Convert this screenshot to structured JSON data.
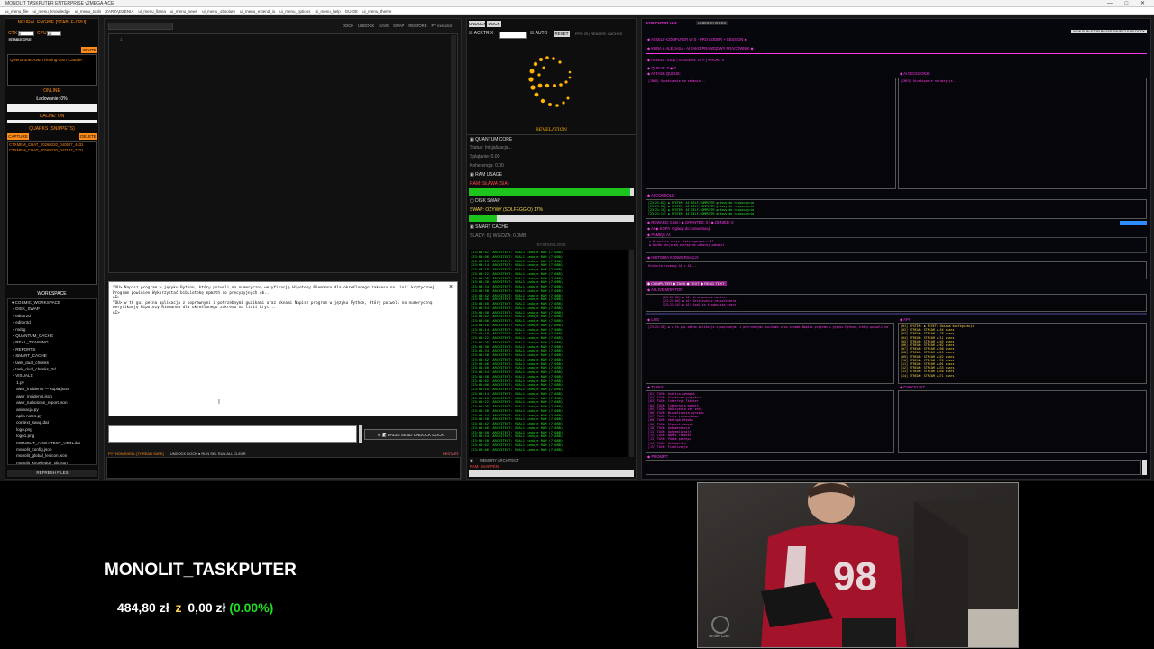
{
  "window": {
    "title": "MONOLIT TASKPUTER ENTERPRISE v2MEGA-ACE",
    "controls": [
      "—",
      "□",
      "✕"
    ]
  },
  "menubar": [
    "ui_menu_file",
    "ui_menu_knowledge",
    "ui_menu_tools",
    "ZARZĄDZENIA",
    "ui_menu_llama",
    "ui_menu_news",
    "ui_menu_obsolute",
    "ui_menu_extend_io",
    "ui_menu_options",
    "ui_menu_help",
    "GUIDE",
    "ui_menu_theme"
  ],
  "left": {
    "engine_title": "NEURAL ENGINE [STABLE-CPU]",
    "ctx_label": "CTX",
    "ctx_value": "0",
    "cpu_label": "CPU",
    "cpu_value": "16",
    "stable_tag": "[STABLE CPU]",
    "ignite": "IGNITE",
    "model": "Qwen3-30B-A3B-Thinking-2507-Claude-",
    "online": "ONLINE",
    "loading": "Ładowanie: 0%",
    "cache": "CACHE: ON",
    "quarks": "QUARKS (SNIPPETS)",
    "capture": "CAPTURE",
    "delete": "DELETE",
    "snippets": [
      "CTXMEM_CHAT_20260220_040527_4431",
      "CTXMEM_CHAT_20260220_043137_2221"
    ],
    "workspace": "WORKSPACE",
    "tree": [
      "COSMIC_WORKSPACE",
      "DISK_SWAP",
      "editor2d",
      "editor3d",
      "mdzg",
      "QUANTUM_CACHE",
      "REAL_TRAINING",
      "REPORTS",
      "SMART_CACHE",
      "task_dual_chunks",
      "task_dual_chunks_3d",
      "VISUALS",
      "1.py",
      "aiwir_incidents — kopia.json",
      "aiwir_incidents.json",
      "aiwir_turboscan_report.json",
      "animacja.py",
      "aplia notes.py",
      "context_swap.dat",
      "logo.png",
      "logo1.png",
      "MONOLIT_ARCHITECT_VEIN.dat",
      "monolit_config.json",
      "monolit_global_lexicon.json",
      "monolit_knowledge_db.json"
    ],
    "refresh": "REFRESH FILES"
  },
  "editor": {
    "tab": "",
    "toolbar": [
      "DOCK",
      "UNDOCK",
      "SAVE",
      "SWAP",
      "RESTORE",
      "PY executor"
    ],
    "line_no": "1",
    "chat": "YOU> Napisz program w języku Python, który pozwoli na numeryczną weryfikację Hipotezy Riemanna dla określonego zakresu na linii krytycznej. Program powinien:Wykorzystać bibliotekę mpmath do precyzyjnych ob...\nAI>\nYOU> w tk gui pełna aplikacja z poprawnymi i potrzebnymi guzikami oraz oknami Napisz program w języku Python, który pozwoli na numeryczną weryfikację Hipotezy Riemanna dla określonego zakresu na linii kryt...\nAI>",
    "send_buttons": "⚙ 🗐 DALEJ SEND UNDOCK DOCK",
    "shell_label": "PYTHON SHELL [THREAD SAFE]",
    "shell_buttons": "UNDOCK DOCK ● RUN SEL RUN ALL CLEAR",
    "shell_right": "RESTART"
  },
  "middle": {
    "undock": "UNDOCK",
    "dock": "DOCK",
    "acktrix": "ACKTRIX",
    "auto": "AUTO",
    "reset": "RESET",
    "stats": "FPS: 25 | RENDER: CACHED",
    "revelation": "REVELATION",
    "quantum_core": "QUANTUM CORE",
    "status": "Status: Inicjalizacja...",
    "splatanie": "Splątanie: 0.00",
    "koherencja": "Koherencja: 0.00",
    "ram_usage": "RAM USAGE",
    "ram_line": "RAM: SŁAWA (SIA)",
    "ram_fill": 0.98,
    "disk_swap": "DISK SWAP",
    "swap_line": "SWAP: OŻYWY (SOLFEGGIO) 17%",
    "swap_fill": 0.17,
    "smart_cache": "SMART CACHE",
    "slady": "ŚLADY: 6 | WIEDZA: 0.0MB",
    "system_logs": "SYSTEM LOGS",
    "log_lines": [
      "[23:03:02] ARCHITECT: VIAL1 Ładuje RAM (7.08B)",
      "[23:03:06] ARCHITECT: VIAL1 Ładuje RAM (7.08B)",
      "[23:03:10] ARCHITECT: VIAL1 Ładuje RAM (7.08B)",
      "[23:03:14] ARCHITECT: VIAL1 Ładuje RAM (7.08B)",
      "[23:03:18] ARCHITECT: VIAL1 Ładuje RAM (7.08B)",
      "[23:03:22] ARCHITECT: VIAL1 Ładuje RAM (7.08B)",
      "[23:03:26] ARCHITECT: VIAL1 Ładuje RAM (7.08B)",
      "[23:03:30] ARCHITECT: VIAL1 Ładuje RAM (7.08B)",
      "[23:03:34] ARCHITECT: VIAL1 Ładuje RAM (7.08B)",
      "[23:03:38] ARCHITECT: VIAL1 Ładuje RAM (7.08B)",
      "[23:03:42] ARCHITECT: VIAL1 Ładuje RAM (7.08B)",
      "[23:03:46] ARCHITECT: VIAL1 Ładuje RAM (7.08B)",
      "[23:03:50] ARCHITECT: VIAL1 Ładuje RAM (7.08B)",
      "[23:03:54] ARCHITECT: VIAL1 Ładuje RAM (7.08B)",
      "[23:03:58] ARCHITECT: VIAL1 Ładuje RAM (7.08B)",
      "[23:04:02] ARCHITECT: VIAL1 Ładuje RAM (7.08B)",
      "[23:04:06] ARCHITECT: VIAL1 Ładuje RAM (7.08B)",
      "[23:04:10] ARCHITECT: VIAL1 Ładuje RAM (7.08B)",
      "[23:04:14] ARCHITECT: VIAL1 Ładuje RAM (7.08B)",
      "[23:04:18] ARCHITECT: VIAL1 Ładuje RAM (7.08B)",
      "[23:04:22] ARCHITECT: VIAL1 Ładuje RAM (7.08B)",
      "[23:04:26] ARCHITECT: VIAL1 Ładuje RAM (7.08B)",
      "[23:04:30] ARCHITECT: VIAL1 Ładuje RAM (7.08B)",
      "[23:04:34] ARCHITECT: VIAL1 Ładuje RAM (7.08B)",
      "[23:04:38] ARCHITECT: VIAL1 Ładuje RAM (7.08B)",
      "[23:04:42] ARCHITECT: VIAL1 Ładuje RAM (7.08B)",
      "[23:04:46] ARCHITECT: VIAL1 Ładuje RAM (7.08B)",
      "[23:04:50] ARCHITECT: VIAL1 Ładuje RAM (7.08B)",
      "[23:04:54] ARCHITECT: VIAL1 Ładuje RAM (7.08B)",
      "[23:04:58] ARCHITECT: VIAL1 Ładuje RAM (7.08B)",
      "[23:05:02] ARCHITECT: VIAL1 Ładuje RAM (7.08B)",
      "[23:05:06] ARCHITECT: VIAL1 Ładuje RAM (7.08B)",
      "[23:05:10] ARCHITECT: VIAL1 Ładuje RAM (7.08B)",
      "[23:05:14] ARCHITECT: VIAL1 Ładuje RAM (7.08B)",
      "[23:05:18] ARCHITECT: VIAL1 Ładuje RAM (7.08B)",
      "[23:05:22] ARCHITECT: VIAL1 Ładuje RAM (7.08B)",
      "[23:05:26] ARCHITECT: VIAL1 Ładuje RAM (7.08B)",
      "[23:05:30] ARCHITECT: VIAL1 Ładuje RAM (7.08B)",
      "[23:05:34] ARCHITECT: VIAL1 Ładuje RAM (7.08B)",
      "[23:05:38] ARCHITECT: VIAL1 Ładuje RAM (7.08B)",
      "[23:05:42] ARCHITECT: VIAL1 Ładuje RAM (7.08B)",
      "[23:05:46] ARCHITECT: VIAL1 Ładuje RAM (7.08B)",
      "[23:05:50] ARCHITECT: VIAL1 Ładuje RAM (7.08B)",
      "[23:05:54] ARCHITECT: VIAL1 Ładuje RAM (7.08B)",
      "[23:05:58] ARCHITECT: VIAL1 Ładuje RAM (7.08B)",
      "[23:06:02] ARCHITECT: VIAL1 Ładuje RAM (7.08B)",
      "[23:06:06] ARCHITECT: VIAL1 Ładuje RAM (7.08B)"
    ],
    "memory_architect": "MEMORY ARCHITECT",
    "ram_sharpen": "RAM: SHARPEN"
  },
  "right": {
    "title": "TASKPUTER v1.0",
    "tabs": "UNDOCK DOCK",
    "top_right_buttons": "NEW RUN STOP PAUSE SAVE CLEAR DOCK",
    "header1": "◆ AI SELF-COMPUTER v7.0 - PRO KODER + SESSION ◆",
    "header2": "◆ KUBA & ALE JASA - AI JAKO PRAWDZIWY PRACOWNIK ◆",
    "status_line": "◆ AI SELF: IDLE | SESSION: OFF | KROKI: 0",
    "queue_line": "◆ QUEUE: 0 ◆ 0",
    "task_queue_label": "◆ AI TASK QUEUE:",
    "task_queue_text": "[INFO] Oczekiwanie na zadania...",
    "decisions_label": "◆ AI DECISIONS:",
    "decisions_text": "[INFO] Oczekiwanie na decyzje...",
    "console_label": "◆ AI CONSOLE:",
    "console_lines": [
      "[23:21:02] ◆ SYSTEM: AI SELF-COMPUTER gotowy do rozpoczęcia",
      "[23:21:06] ◆ SYSTEM: AI SELF-COMPUTER gotowy do rozpoczęcia",
      "[23:21:10] ◆ SYSTEM: AI SELF-COMPUTER gotowy do rozpoczęcia",
      "[23:21:14] ◆ SYSTEM: AI SELF-COMPUTER gotowy do rozpoczęcia"
    ],
    "rewards_line": "◆ REWARD: 0 pts | ◆ GRANTED: 0 | ◆ DENIED: 0",
    "ai_label": "◆ AI ◆ KOPA: Oglady do konwersacji",
    "memory_label": "◆ PAMIĘĆ AI:",
    "memory_lines": [
      "◆ Wszystkie akcje skatalogowane w AI",
      "◆ Każda akcja ma dostęp do własnej pamięci"
    ],
    "history_label": "◆ HISTORIA KONWERSACJI:",
    "history_text": "Historia rozmowy AI z AI...",
    "mode_buttons": "◆ COMPUTER  ◆ TASK  ◆ TEXT  ◆ READ TEXT",
    "live_label": "◆ AI LIVE MONITOR:",
    "live_lines": [
      "[23:21:02] ◆ AI: Uruchomiono monitor",
      "[23:21:06] ◆ AI: Oczekiwanie na polecenia",
      "[23:21:10] ◆ AI: Analiza środowiska pracy"
    ],
    "log_label": "◆ LOG",
    "log_text": "[23:21:38] ◆ w tk gui pełna aplikacja z poprawnymi i potrzebnymi guzikami oraz oknami Napisz program w języku Python, który pozwoli na",
    "api_label": "◆ API",
    "api_lines": [
      "[01] SYSTEM: ◆ RESET: Zmiana konfiguracji",
      "[02] STREAM: STREAM +144 chars",
      "[03] STREAM: STREAM +178 chars",
      "[04] STREAM: STREAM +211 chars",
      "[05] STREAM: STREAM +245 chars",
      "[06] STREAM: STREAM +262 chars",
      "[07] STREAM: STREAM +298 chars",
      "[08] STREAM: STREAM +315 chars",
      "[09] STREAM: STREAM +342 chars",
      "[10] STREAM: STREAM +376 chars",
      "[11] STREAM: STREAM +401 chars",
      "[12] STREAM: STREAM +433 chars",
      "[13] STREAM: STREAM +458 chars",
      "[14] STREAM: STREAM +471 chars"
    ],
    "tasks_label": "◆ TASKS",
    "tasks_lines": [
      "[01] TASK: Analiza wymagań",
      "[02] TASK: Struktura projektu",
      "[03] TASK: Interfejs Tkinter",
      "[04] TASK: Integracja mpmath",
      "[05] TASK: Obliczenia zer zeta",
      "[06] TASK: Wizualizacja wyników",
      "[07] TASK: Testy jednostkowe",
      "[08] TASK: Obsługa błędów",
      "[09] TASK: Eksport danych",
      "[10] TASK: Dokumentacja",
      "[11] TASK: Optymalizacja",
      "[12] TASK: Wątki robocze",
      "[13] TASK: Pasek postępu",
      "[14] TASK: Ustawienia",
      "[15] TASK: Finalizacja"
    ],
    "checklist_label": "◆ CHECKLIST",
    "prompt_label": "◆ PROMPT:"
  },
  "bottom": {
    "brand": "MONOLIT_TASKPUTER",
    "price_main": "484,80 zł",
    "price_z": "z",
    "price_change": "0,00 zł",
    "price_pct": "(0.00%)"
  },
  "webcam": {
    "caption": "Archie Cam"
  },
  "colors": {
    "accent_orange": "#ff8c1a",
    "log_green": "#2ee82e",
    "magenta": "#ff39e6",
    "price_green": "#1ee01e"
  }
}
